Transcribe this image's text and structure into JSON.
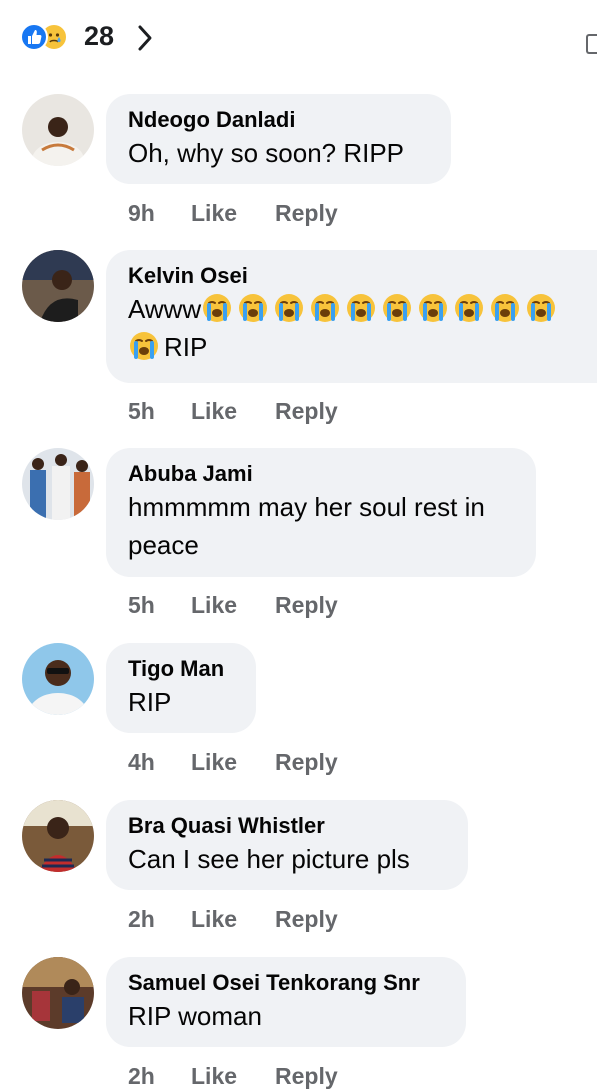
{
  "reactions": {
    "count": "28",
    "icons": [
      "like-icon",
      "sad-icon"
    ],
    "colors": {
      "like": "#1877f2",
      "sad": "#f7c33b"
    }
  },
  "actions": {
    "like_label": "Like",
    "reply_label": "Reply"
  },
  "comments": [
    {
      "author": "Ndeogo Danladi",
      "text": "Oh, why so soon? RIPP",
      "time": "9h"
    },
    {
      "author": "Kelvin Osei",
      "text_prefix": "Awww",
      "text_suffix": "RIP",
      "emoji": "crying-face-icon",
      "emoji_count": 11,
      "time": "5h"
    },
    {
      "author": "Abuba Jami",
      "text": "hmmmmm may her soul rest in peace",
      "time": "5h"
    },
    {
      "author": "Tigo Man",
      "text": "RIP",
      "time": "4h"
    },
    {
      "author": "Bra Quasi Whistler",
      "text": "Can I see her picture pls",
      "time": "2h"
    },
    {
      "author": "Samuel Osei Tenkorang Snr",
      "text": "RIP woman",
      "time": "2h"
    }
  ],
  "colors": {
    "bubble": "#f0f2f5",
    "meta": "#65676b",
    "text": "#050505"
  }
}
